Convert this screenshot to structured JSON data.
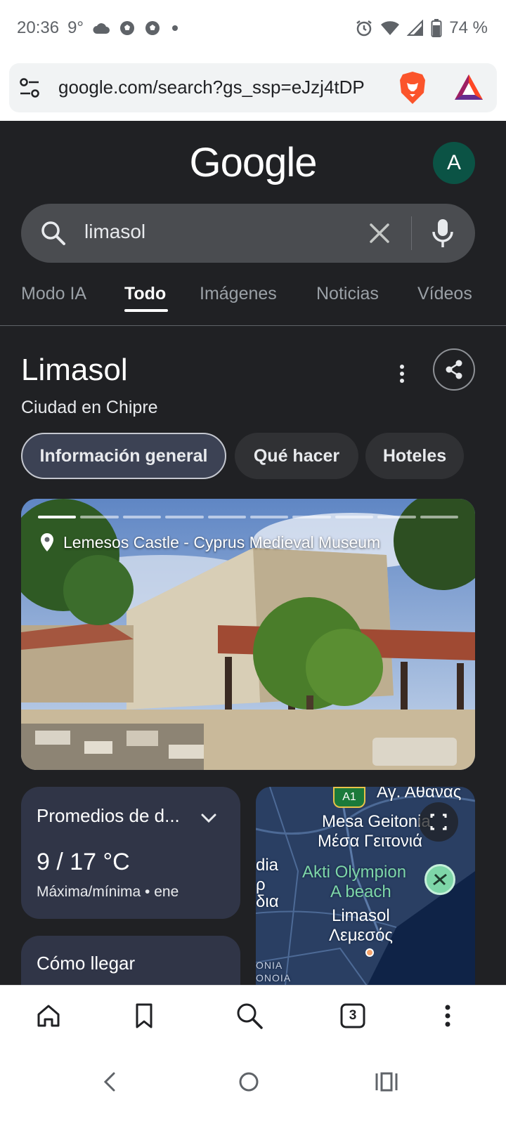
{
  "status_bar": {
    "time": "20:36",
    "temperature": "9°",
    "battery": "74 %",
    "icons_left": [
      "cloud-icon",
      "soccer-ball-icon",
      "soccer-ball-icon",
      "dot-icon"
    ],
    "icons_right": [
      "alarm-icon",
      "wifi-icon",
      "signal-icon",
      "battery-icon"
    ]
  },
  "address_bar": {
    "url": "google.com/search?gs_ssp=eJzj4tDP"
  },
  "google": {
    "logo": "Google",
    "avatar_letter": "A",
    "search_query": "limasol",
    "tabs": [
      "Modo IA",
      "Todo",
      "Imágenes",
      "Noticias",
      "Vídeos"
    ],
    "active_tab": "Todo"
  },
  "knowledge_panel": {
    "title": "Limasol",
    "subtitle": "Ciudad en Chipre",
    "chips": [
      "Información general",
      "Qué hacer",
      "Hoteles"
    ],
    "selected_chip": "Información general",
    "hero_caption": "Lemesos Castle - Cyprus Medieval Museum",
    "hero_progress": {
      "total_segments": 10,
      "current_segment": 1
    },
    "weather": {
      "title": "Promedios de d...",
      "temperature": "9 / 17 °C",
      "subtitle": "Máxima/mínima • ene"
    },
    "directions": {
      "title": "Cómo llegar"
    },
    "map": {
      "labels": {
        "top_greek": "Αγ. Αθανας",
        "road": "A1",
        "district_en": "Mesa Geitonia",
        "district_gr": "Μέσα Γειτονιά",
        "left_1": "dia",
        "left_2": "ρ",
        "left_3": "δια",
        "beach_1": "Akti Olympion",
        "beach_2": "A beach",
        "city_en": "Limasol",
        "city_gr": "Λεμεσός",
        "small_1": "ONIA",
        "small_2": "ONOIA"
      }
    }
  },
  "bottom_toolbar": {
    "tabs_count": "3",
    "items": [
      "home-icon",
      "bookmark-icon",
      "search-icon",
      "tabs-icon",
      "more-icon"
    ]
  },
  "nav_bar": {
    "items": [
      "back-icon",
      "home-circle-icon",
      "recents-icon"
    ]
  },
  "colors": {
    "page_bg": "#202124",
    "card_bg": "#303547",
    "avatar_bg": "#0b5345",
    "search_bg": "#4a4c50"
  }
}
